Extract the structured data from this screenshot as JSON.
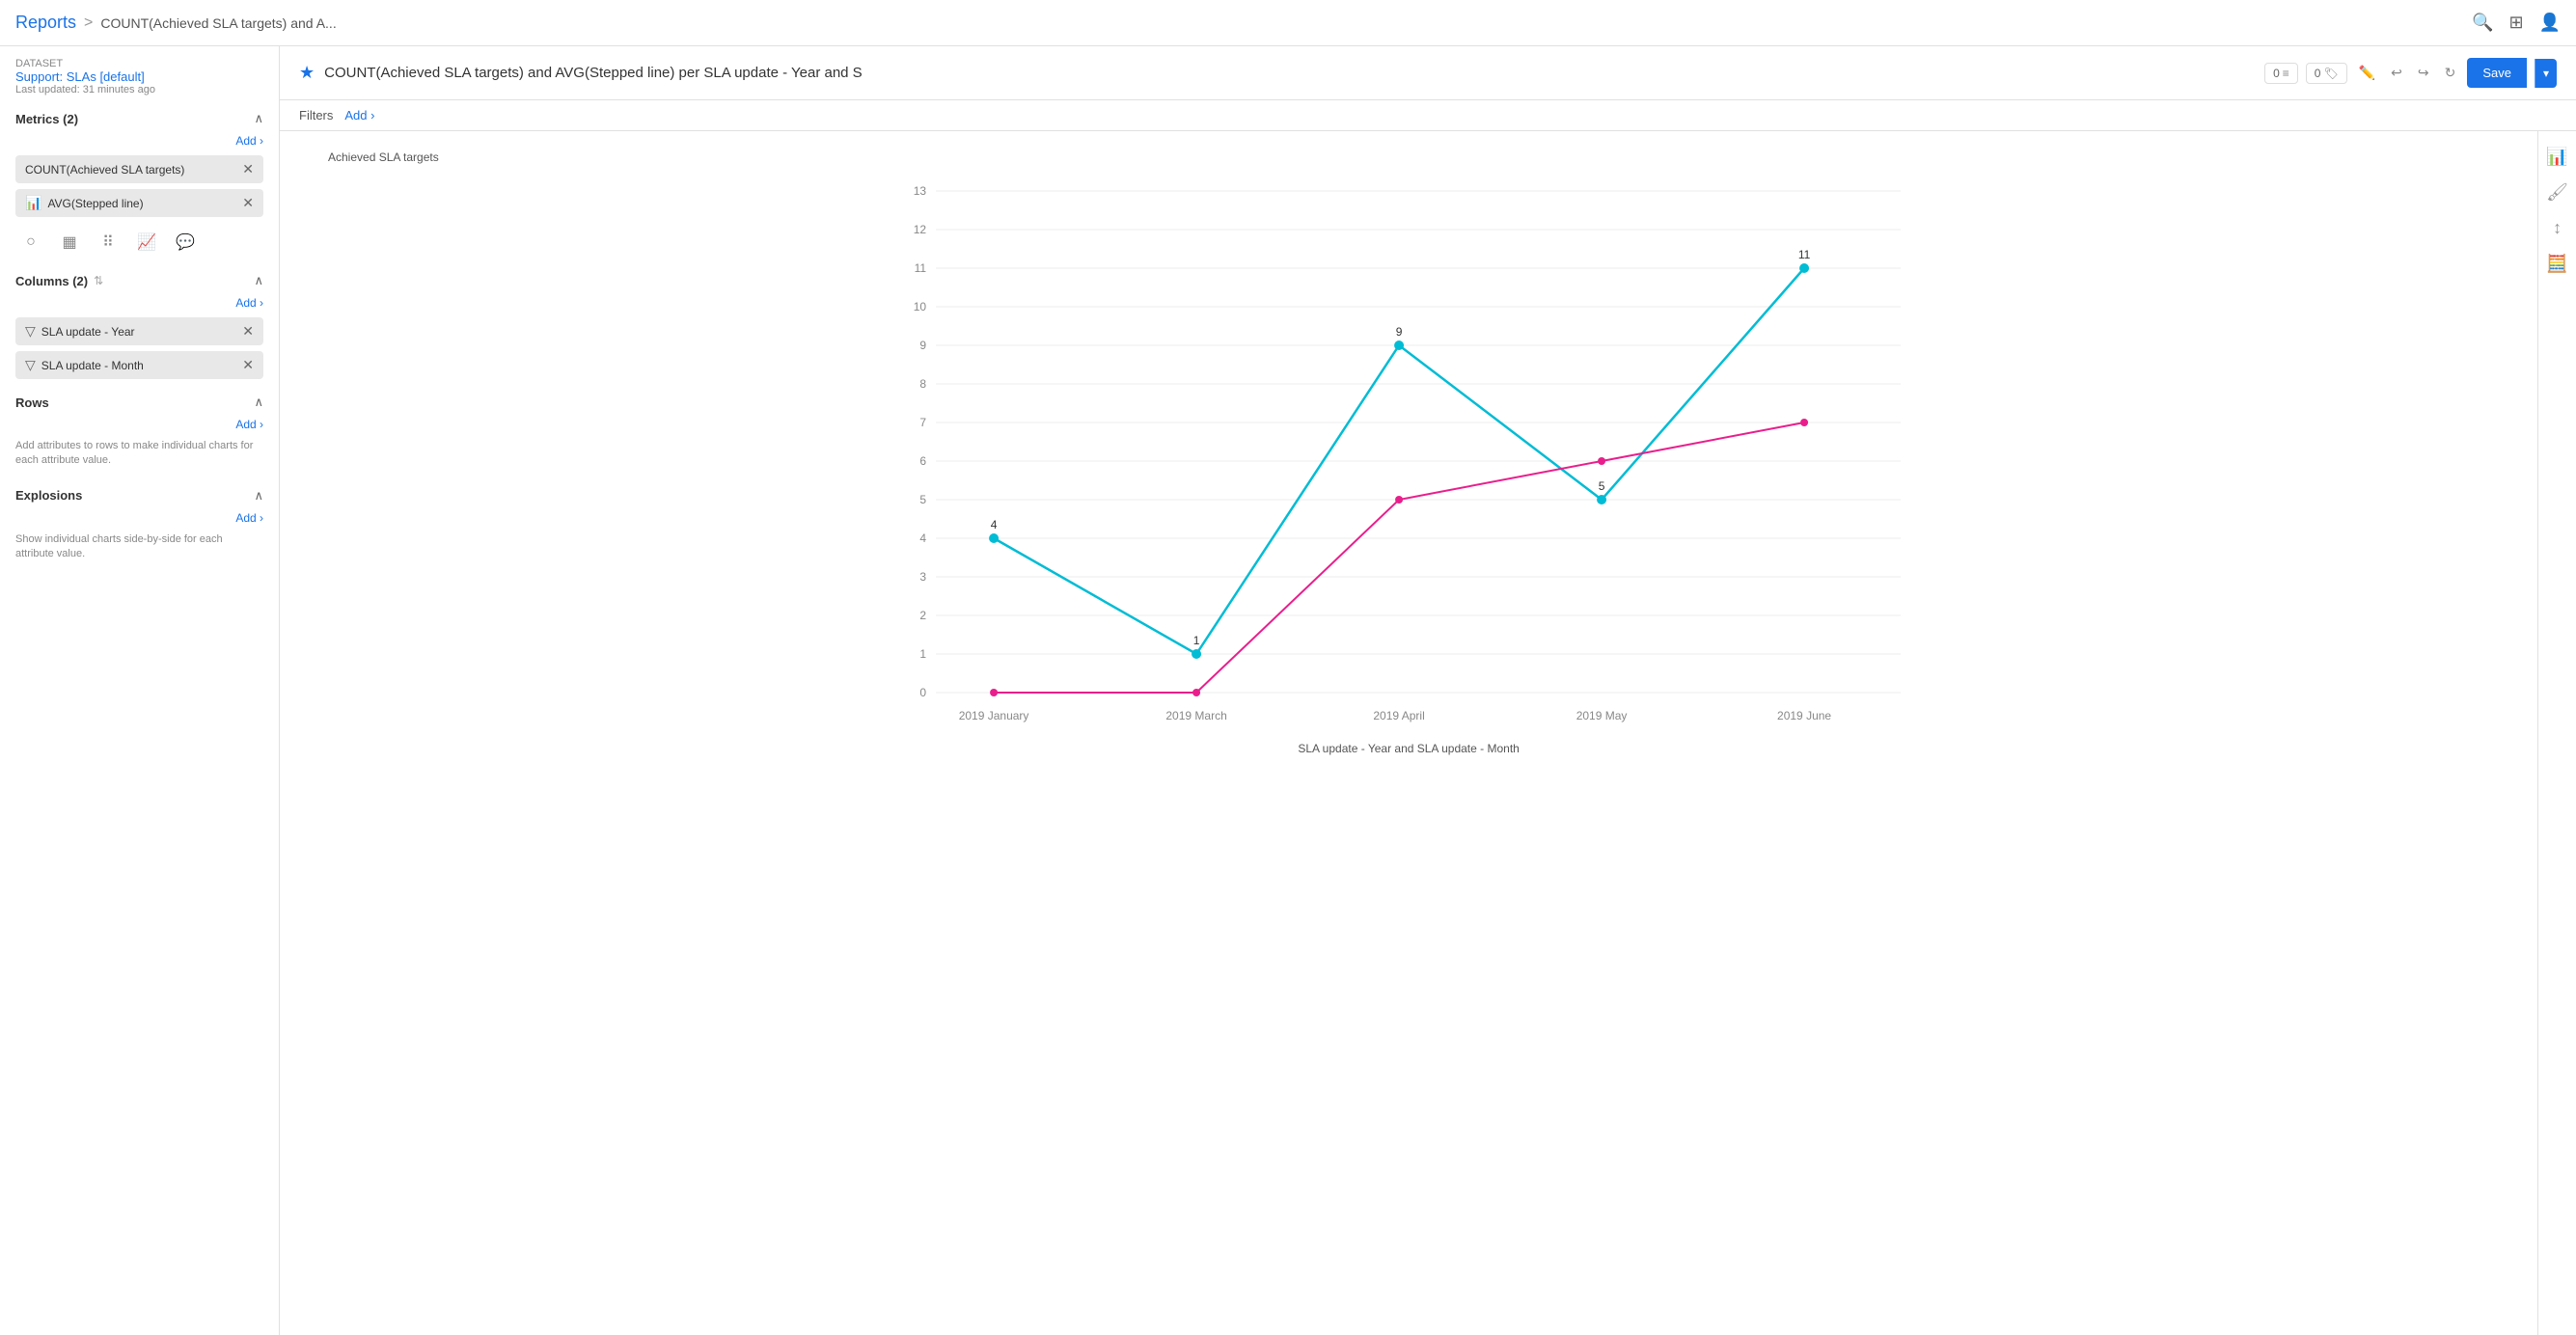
{
  "nav": {
    "reports_label": "Reports",
    "separator": ">",
    "breadcrumb": "COUNT(Achieved SLA targets) and A..."
  },
  "dataset": {
    "label": "Dataset",
    "name": "Support: SLAs [default]",
    "updated": "Last updated: 31 minutes ago"
  },
  "metrics": {
    "section_title": "Metrics (2)",
    "add_label": "Add ›",
    "items": [
      {
        "label": "COUNT(Achieved SLA targets)",
        "has_icon": false
      },
      {
        "label": "AVG(Stepped line)",
        "has_icon": true
      }
    ]
  },
  "columns": {
    "section_title": "Columns (2)",
    "add_label": "Add ›",
    "items": [
      {
        "label": "SLA update - Year"
      },
      {
        "label": "SLA update - Month"
      }
    ]
  },
  "rows": {
    "section_title": "Rows",
    "add_label": "Add ›",
    "desc": "Add attributes to rows to make individual charts for each attribute value."
  },
  "explosions": {
    "section_title": "Explosions",
    "add_label": "Add ›",
    "desc": "Show individual charts side-by-side for each attribute value."
  },
  "report": {
    "title": "COUNT(Achieved SLA targets) and AVG(Stepped line) per SLA update - Year and S",
    "filter_label": "Filters",
    "add_filter": "Add ›",
    "badge1_count": "0",
    "badge2_count": "0",
    "save_label": "Save"
  },
  "chart": {
    "y_axis_label": "Achieved SLA targets",
    "x_axis_label": "SLA update - Year and SLA update - Month",
    "y_ticks": [
      "13",
      "12",
      "11",
      "10",
      "9",
      "8",
      "7",
      "6",
      "5",
      "4",
      "3",
      "2",
      "1",
      "0"
    ],
    "x_ticks": [
      "2019 January",
      "2019 March",
      "2019 April",
      "2019 May",
      "2019 June"
    ],
    "cyan_points": [
      {
        "label": "4",
        "x": 60,
        "y": 72
      },
      {
        "label": "1",
        "x": 320,
        "y": 88
      },
      {
        "label": "9",
        "x": 510,
        "y": 28
      },
      {
        "label": "5",
        "x": 700,
        "y": 52
      },
      {
        "label": "11",
        "x": 900,
        "y": 8
      }
    ],
    "pink_points": [
      {
        "x": 60,
        "y": 98
      },
      {
        "x": 320,
        "y": 95
      },
      {
        "x": 510,
        "y": 60
      },
      {
        "x": 700,
        "y": 50
      },
      {
        "x": 900,
        "y": 32
      }
    ]
  }
}
